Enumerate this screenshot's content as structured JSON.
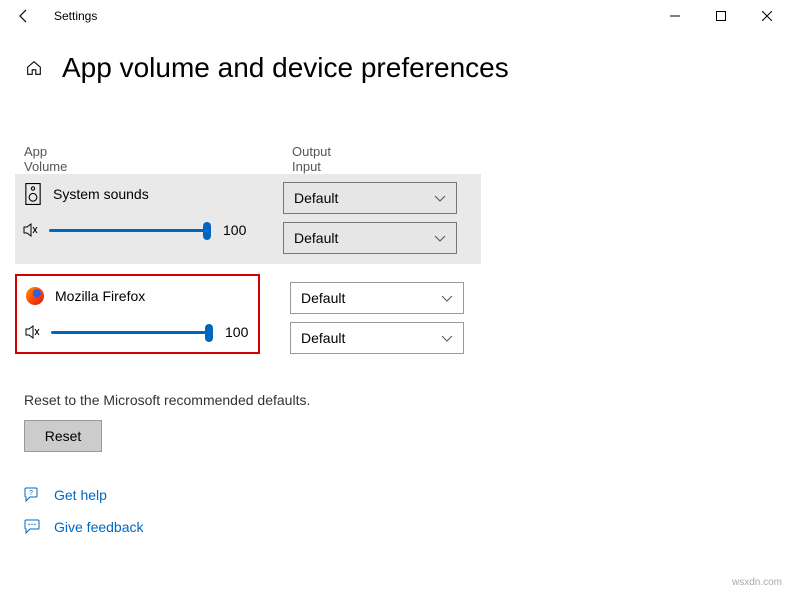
{
  "window": {
    "title": "Settings"
  },
  "page": {
    "heading": "App volume and device preferences"
  },
  "columns": {
    "app": "App",
    "volume": "Volume",
    "output": "Output",
    "input": "Input"
  },
  "apps": [
    {
      "name": "System sounds",
      "volume": 100,
      "output": "Default",
      "input": "Default"
    },
    {
      "name": "Mozilla Firefox",
      "volume": 100,
      "output": "Default",
      "input": "Default"
    }
  ],
  "reset": {
    "desc": "Reset to the Microsoft recommended defaults.",
    "button": "Reset"
  },
  "links": {
    "help": "Get help",
    "feedback": "Give feedback"
  },
  "watermark": "wsxdn.com"
}
